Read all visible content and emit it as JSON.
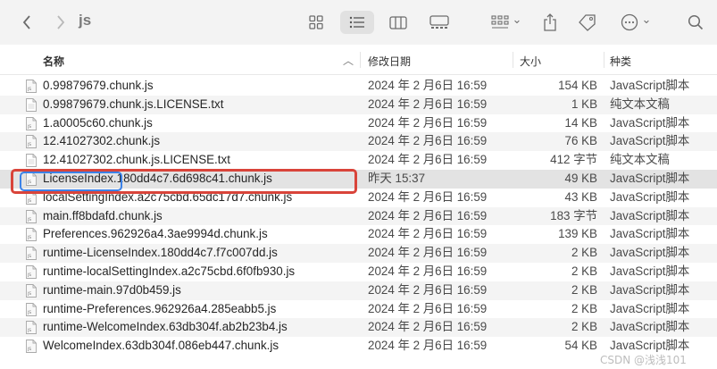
{
  "toolbar": {
    "title": "js",
    "view_sort_chevron": "⌄",
    "more_chevron": "⌄"
  },
  "header": {
    "name": "名称",
    "date": "修改日期",
    "size": "大小",
    "kind": "种类",
    "sort_indicator": "︿"
  },
  "files": [
    {
      "name": "0.99879679.chunk.js",
      "date": "2024 年 2 月6日 16:59",
      "size": "154 KB",
      "kind": "JavaScript脚本",
      "icon": "js-file-icon"
    },
    {
      "name": "0.99879679.chunk.js.LICENSE.txt",
      "date": "2024 年 2 月6日 16:59",
      "size": "1 KB",
      "kind": "纯文本文稿",
      "icon": "txt-file-icon"
    },
    {
      "name": "1.a0005c60.chunk.js",
      "date": "2024 年 2 月6日 16:59",
      "size": "14 KB",
      "kind": "JavaScript脚本",
      "icon": "js-file-icon"
    },
    {
      "name": "12.41027302.chunk.js",
      "date": "2024 年 2 月6日 16:59",
      "size": "76 KB",
      "kind": "JavaScript脚本",
      "icon": "js-file-icon"
    },
    {
      "name": "12.41027302.chunk.js.LICENSE.txt",
      "date": "2024 年 2 月6日 16:59",
      "size": "412 字节",
      "kind": "纯文本文稿",
      "icon": "txt-file-icon"
    },
    {
      "name": "LicenseIndex.180dd4c7.6d698c41.chunk.js",
      "date": "昨天 15:37",
      "size": "49 KB",
      "kind": "JavaScript脚本",
      "icon": "js-file-icon"
    },
    {
      "name": "localSettingIndex.a2c75cbd.65dc17d7.chunk.js",
      "date": "2024 年 2 月6日 16:59",
      "size": "43 KB",
      "kind": "JavaScript脚本",
      "icon": "js-file-icon"
    },
    {
      "name": "main.ff8bdafd.chunk.js",
      "date": "2024 年 2 月6日 16:59",
      "size": "183 字节",
      "kind": "JavaScript脚本",
      "icon": "js-file-icon"
    },
    {
      "name": "Preferences.962926a4.3ae9994d.chunk.js",
      "date": "2024 年 2 月6日 16:59",
      "size": "139 KB",
      "kind": "JavaScript脚本",
      "icon": "js-file-icon"
    },
    {
      "name": "runtime-LicenseIndex.180dd4c7.f7c007dd.js",
      "date": "2024 年 2 月6日 16:59",
      "size": "2 KB",
      "kind": "JavaScript脚本",
      "icon": "js-file-icon"
    },
    {
      "name": "runtime-localSettingIndex.a2c75cbd.6f0fb930.js",
      "date": "2024 年 2 月6日 16:59",
      "size": "2 KB",
      "kind": "JavaScript脚本",
      "icon": "js-file-icon"
    },
    {
      "name": "runtime-main.97d0b459.js",
      "date": "2024 年 2 月6日 16:59",
      "size": "2 KB",
      "kind": "JavaScript脚本",
      "icon": "js-file-icon"
    },
    {
      "name": "runtime-Preferences.962926a4.285eabb5.js",
      "date": "2024 年 2 月6日 16:59",
      "size": "2 KB",
      "kind": "JavaScript脚本",
      "icon": "js-file-icon"
    },
    {
      "name": "runtime-WelcomeIndex.63db304f.ab2b23b4.js",
      "date": "2024 年 2 月6日 16:59",
      "size": "2 KB",
      "kind": "JavaScript脚本",
      "icon": "js-file-icon"
    },
    {
      "name": "WelcomeIndex.63db304f.086eb447.chunk.js",
      "date": "2024 年 2 月6日 16:59",
      "size": "54 KB",
      "kind": "JavaScript脚本",
      "icon": "js-file-icon"
    }
  ],
  "selected_index": 5,
  "watermark": "CSDN @浅浅101",
  "colors": {
    "highlight_red": "#d9443a",
    "highlight_blue": "#3b82e8",
    "selected_row": "#e3e3e3"
  }
}
